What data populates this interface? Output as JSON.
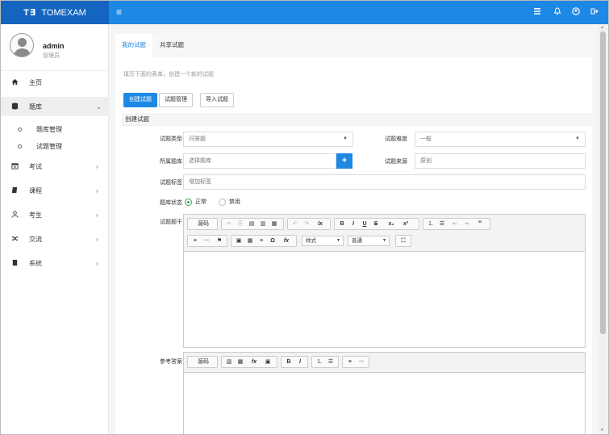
{
  "brand": {
    "logo": "T∃",
    "name": "TOMEXAM"
  },
  "topbar": {
    "menu_icon": "≡",
    "icons": [
      "list-icon",
      "bell-icon",
      "user-circle-icon",
      "logout-icon"
    ]
  },
  "user": {
    "name": "admin",
    "role": "管理员"
  },
  "sidebar": {
    "items": [
      {
        "label": "主页",
        "icon": "home-icon"
      },
      {
        "label": "题库",
        "icon": "database-icon"
      },
      {
        "label": "题库管理"
      },
      {
        "label": "试题管理"
      },
      {
        "label": "考试",
        "icon": "calendar-icon"
      },
      {
        "label": "课程",
        "icon": "book-icon"
      },
      {
        "label": "考生",
        "icon": "person-icon"
      },
      {
        "label": "交流",
        "icon": "shuffle-icon"
      },
      {
        "label": "系统",
        "icon": "server-icon"
      }
    ]
  },
  "tabs": [
    "我的试题",
    "共享试题"
  ],
  "hint": "填写下面的表单，创建一个新的试题",
  "buttons": {
    "create": "创建试题",
    "manage": "试题管理",
    "import": "导入试题"
  },
  "section_title": "创建试题",
  "form": {
    "type_label": "试题类型",
    "type_value": "问答题",
    "difficulty_label": "试题难度",
    "difficulty_value": "一般",
    "bank_label": "所属题库",
    "bank_placeholder": "选择题库",
    "source_label": "试题来源",
    "source_placeholder": "原创",
    "tag_label": "试题标签",
    "tag_placeholder": "增加标签",
    "status_label": "题库状态",
    "status_on": "正常",
    "status_off": "禁用",
    "stem_label": "试题题干",
    "answer_label": "参考答案"
  },
  "editor": {
    "source": "源码",
    "style": "样式",
    "format": "普通"
  }
}
